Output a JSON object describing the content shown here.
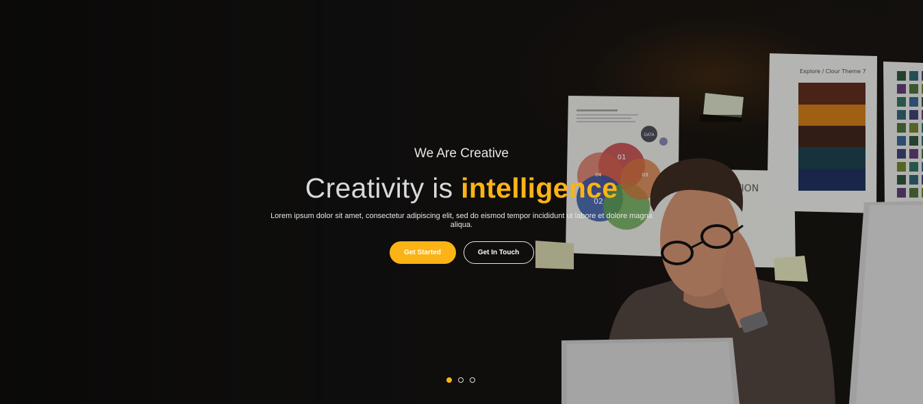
{
  "hero": {
    "tagline": "We Are Creative",
    "headline_plain": "Creativity is",
    "headline_accent": "intelligence",
    "description": "Lorem ipsum dolor sit amet, consectetur adipiscing elit, sed do eismod tempor incididunt ut labore et dolore magna aliqua.",
    "primary_button": "Get Started",
    "secondary_button": "Get In Touch"
  },
  "background": {
    "poster_title": "Explore / Clour Theme 7",
    "poster_badge": "DATA",
    "venn_labels": [
      "01",
      "02",
      "03",
      "04"
    ],
    "partial_word": "TION"
  },
  "slider": {
    "slides": 3,
    "active_slide": 1
  },
  "colors": {
    "accent": "#fbb316",
    "background": "#0b0a09",
    "text": "#ffffff"
  }
}
